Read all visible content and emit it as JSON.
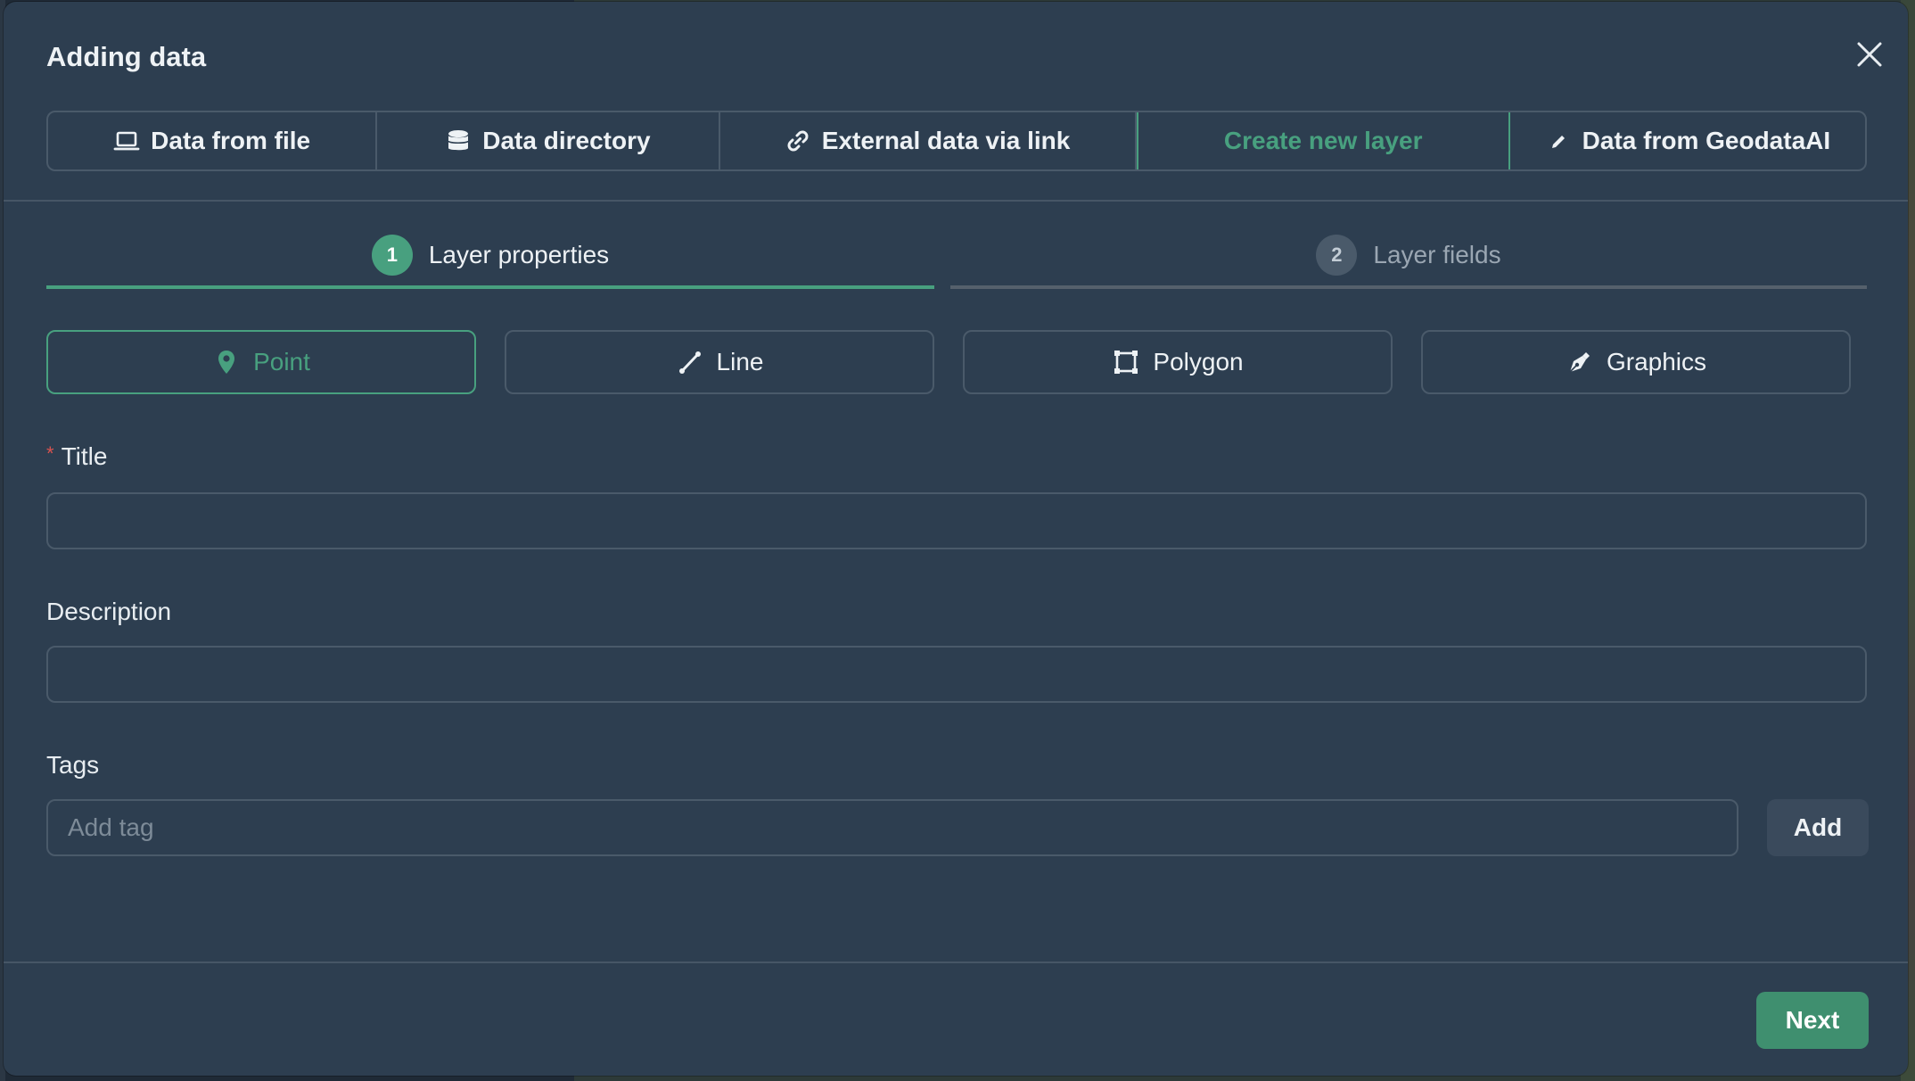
{
  "dialog": {
    "title": "Adding data",
    "close_icon": "close-icon"
  },
  "source_tabs": [
    {
      "label": "Data from file",
      "icon": "laptop-icon"
    },
    {
      "label": "Data directory",
      "icon": "database-icon"
    },
    {
      "label": "External data via link",
      "icon": "link-icon"
    },
    {
      "label": "Create new layer",
      "icon": "",
      "active": true
    },
    {
      "label": "Data from GeodataAI",
      "icon": "pencil-icon"
    }
  ],
  "steps": [
    {
      "number": "1",
      "label": "Layer properties",
      "active": true
    },
    {
      "number": "2",
      "label": "Layer fields",
      "active": false
    }
  ],
  "geometry_types": [
    {
      "label": "Point",
      "icon": "map-pin-icon",
      "active": true
    },
    {
      "label": "Line",
      "icon": "line-icon"
    },
    {
      "label": "Polygon",
      "icon": "polygon-icon"
    },
    {
      "label": "Graphics",
      "icon": "pen-nib-icon"
    }
  ],
  "form": {
    "title_label": "Title",
    "title_required_mark": "*",
    "title_value": "",
    "description_label": "Description",
    "description_value": "",
    "tags_label": "Tags",
    "tags_placeholder": "Add tag",
    "add_button": "Add"
  },
  "footer": {
    "next_button": "Next"
  },
  "colors": {
    "accent": "#48a07f",
    "panel": "#2d3e50",
    "border": "#4a5a6a",
    "next_button_bg": "#3f8f6f"
  }
}
